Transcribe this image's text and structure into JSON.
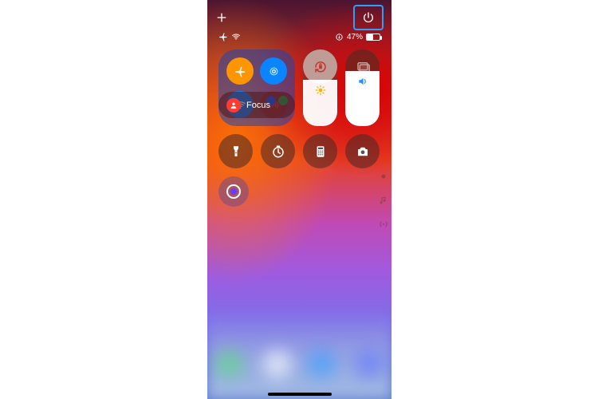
{
  "topbar": {
    "add_icon": "plus-icon",
    "power_icon": "power-icon"
  },
  "statusbar": {
    "airplane_icon": "airplane-icon",
    "wifi_icon": "wifi-icon",
    "orientation_icon": "orientation-lock-icon",
    "battery_percent": "47%",
    "battery_fill": 47
  },
  "connectivity": {
    "airplane": {
      "name": "airplane-mode-toggle",
      "active": true
    },
    "airdrop": {
      "name": "airdrop-toggle",
      "active": true
    },
    "wifi": {
      "name": "wifi-toggle",
      "active": true
    },
    "cellular": {
      "name": "cellular-toggle",
      "active": false
    },
    "bluetooth": {
      "name": "bluetooth-toggle",
      "active": true
    },
    "hotspot": {
      "name": "personal-hotspot-toggle",
      "active": true
    }
  },
  "tiles": {
    "orientation_lock": {
      "name": "orientation-lock-button"
    },
    "screen_mirroring": {
      "name": "screen-mirroring-button"
    }
  },
  "focus": {
    "label": "Focus",
    "icon": "person-icon",
    "name": "focus-button"
  },
  "sliders": {
    "brightness": {
      "name": "brightness-slider",
      "icon": "sun-icon",
      "level": 60
    },
    "volume": {
      "name": "volume-slider",
      "icon": "speaker-icon",
      "level": 72
    }
  },
  "favorite": {
    "icon": "heart-icon"
  },
  "utilities": [
    {
      "name": "flashlight-button",
      "icon": "flashlight-icon"
    },
    {
      "name": "timer-button",
      "icon": "timer-icon"
    },
    {
      "name": "calculator-button",
      "icon": "calculator-icon"
    },
    {
      "name": "camera-button",
      "icon": "camera-icon"
    }
  ],
  "screen_record": {
    "name": "screen-record-button",
    "icon": "record-icon"
  },
  "edge": [
    {
      "name": "edge-dot-indicator",
      "icon": "dot-icon"
    },
    {
      "name": "edge-music-indicator",
      "icon": "music-note-icon"
    },
    {
      "name": "edge-podcast-indicator",
      "icon": "broadcast-icon"
    }
  ]
}
